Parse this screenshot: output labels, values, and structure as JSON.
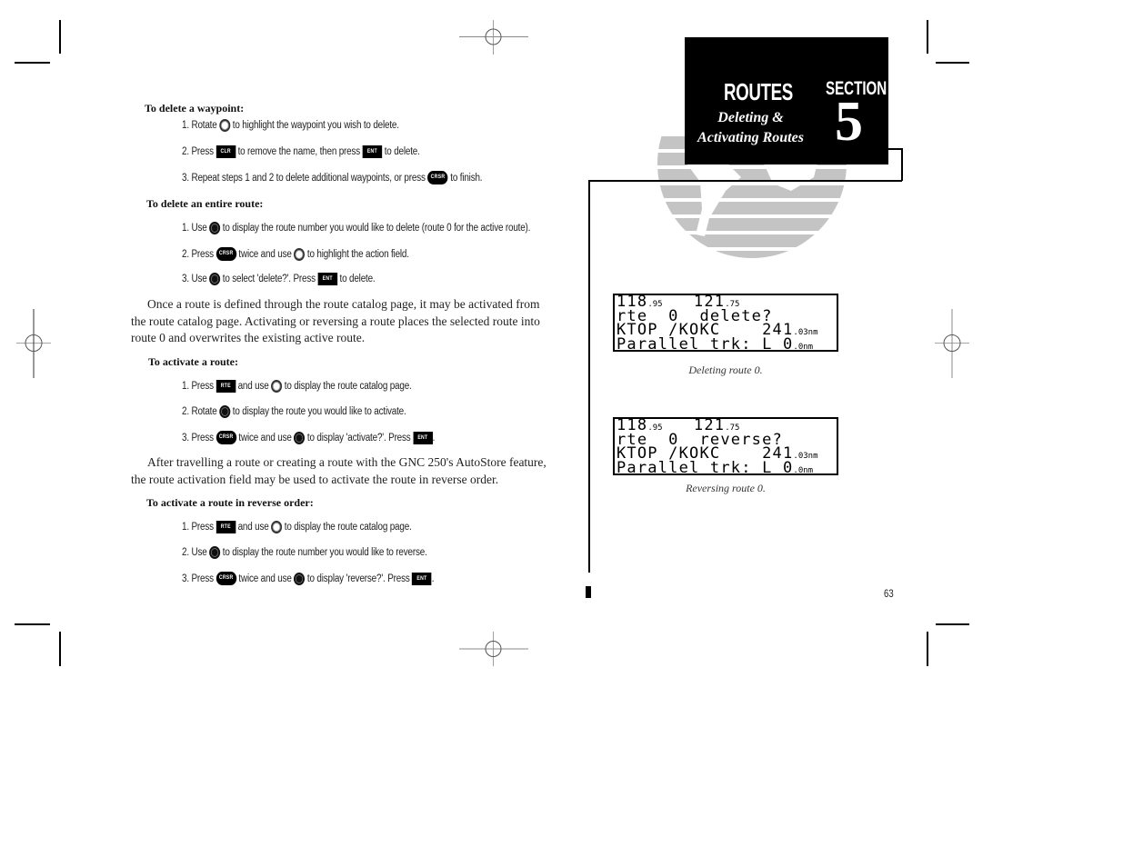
{
  "section": {
    "title": "ROUTES",
    "subtitle_line1": "Deleting &",
    "subtitle_line2": "Activating Routes",
    "label": "SECTION",
    "number": "5"
  },
  "keys": {
    "clr": "CLR",
    "ent": "ENT",
    "crsr": "CRSR",
    "rte": "RTE"
  },
  "delete_waypoint": {
    "heading": "To delete a waypoint:",
    "steps": [
      {
        "a": "1. Rotate",
        "b": "to highlight the waypoint you wish to delete."
      },
      {
        "a": "2. Press",
        "b": "to remove the name, then press",
        "c": "to delete."
      },
      {
        "a": "3. Repeat steps 1 and 2 to delete additional waypoints, or press",
        "b": "to finish."
      }
    ]
  },
  "delete_route": {
    "heading": "To delete an entire route:",
    "steps": [
      {
        "a": "1. Use",
        "b": "to display the route number you would like to delete (route 0 for the active route)."
      },
      {
        "a": "2. Press",
        "b": "twice and use",
        "c": "to highlight the action field."
      },
      {
        "a": "3. Use",
        "b": "to select 'delete?'. Press",
        "c": "to delete."
      }
    ]
  },
  "para1": {
    "text": "Once a route is defined through the route catalog page, it may be activated from the route catalog page. Activating or reversing a route places the selected route into route 0 and overwrites the existing active route."
  },
  "activate_route": {
    "heading": "To activate a route:",
    "steps": [
      {
        "a": "1. Press",
        "b": "and use",
        "c": "to display the route catalog page."
      },
      {
        "a": "2. Rotate",
        "b": "to display the route you would like to activate."
      },
      {
        "a": "3. Press",
        "b": "twice and use",
        "c": "to display 'activate?'. Press",
        "d": "."
      }
    ]
  },
  "para2": {
    "text": "After travelling a route or creating a route with the GNC 250's AutoStore feature, the route activation field may be used to activate the route in reverse order."
  },
  "reverse_route": {
    "heading": "To activate a route in reverse order:",
    "steps": [
      {
        "a": "1. Press",
        "b": "and use",
        "c": "to display the route catalog page."
      },
      {
        "a": "2. Use",
        "b": "to display the route number you would like to reverse."
      },
      {
        "a": "3. Press",
        "b": "twice and use",
        "c": "to display 'reverse?'. Press",
        "d": "."
      }
    ]
  },
  "screens": [
    {
      "lines": {
        "com1": "118",
        "com1_dec": ".95",
        "com2": "121",
        "com2_dec": ".75",
        "line2": "rte  0  delete?",
        "line3": "KTOP /KOKC    241",
        "line3_dec": ".03",
        "line3_unit": "nm",
        "line4": "Parallel trk: L 0",
        "line4_dec": ".0",
        "line4_unit": "nm"
      },
      "caption": "Deleting route 0."
    },
    {
      "lines": {
        "com1": "118",
        "com1_dec": ".95",
        "com2": "121",
        "com2_dec": ".75",
        "line2": "rte  0  reverse?",
        "line3": "KTOP /KOKC    241",
        "line3_dec": ".03",
        "line3_unit": "nm",
        "line4": "Parallel trk: L 0",
        "line4_dec": ".0",
        "line4_unit": "nm"
      },
      "caption": "Reversing route 0."
    }
  ],
  "page_number": "63",
  "colors": {
    "black": "#000000",
    "logo_gray": "#c4c4c4",
    "reg_mark_gray": "#888888"
  }
}
